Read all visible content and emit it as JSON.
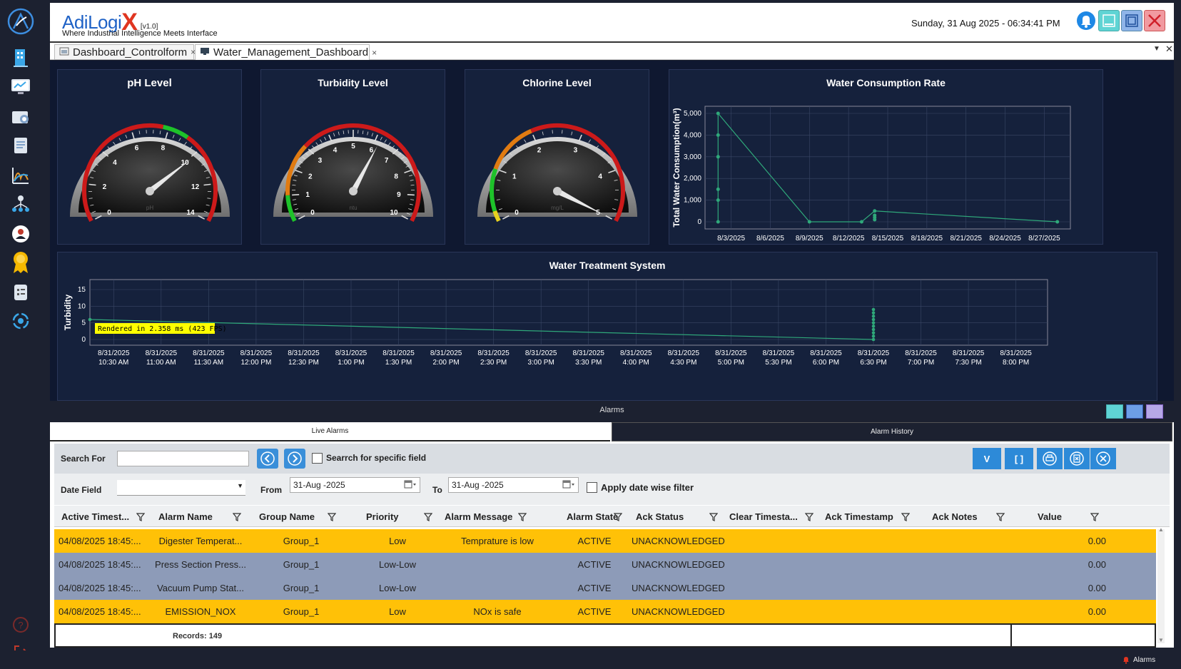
{
  "app": {
    "brand": "AdiLogi",
    "brand_x": "X",
    "version": "[v1.0]",
    "tagline": "Where Industrial Intelligence Meets Interface",
    "datetime": "Sunday, 31 Aug 2025 - 06:34:41 PM"
  },
  "tabs": [
    {
      "label": "Dashboard_Controlform",
      "close": "×"
    },
    {
      "label": "Water_Management_Dashboard",
      "close": "×"
    }
  ],
  "gauges": [
    {
      "title": "pH Level",
      "unit": "pH",
      "min": 0,
      "max": 14,
      "value": 10.1,
      "labels": [
        "0",
        "2",
        "4",
        "6",
        "8",
        "10",
        "12",
        "14"
      ]
    },
    {
      "title": "Turbidity Level",
      "unit": "ntu",
      "min": 0,
      "max": 10,
      "value": 6.2,
      "labels": [
        "0",
        "1",
        "2",
        "3",
        "4",
        "5",
        "6",
        "7",
        "8",
        "9",
        "10"
      ]
    },
    {
      "title": "Chlorine Level",
      "unit": "mg/L",
      "min": 0,
      "max": 5,
      "value": 5.0,
      "labels": [
        "0",
        "1",
        "2",
        "3",
        "4",
        "5"
      ]
    }
  ],
  "consumption_chart": {
    "title": "Water Consumption Rate",
    "ylabel": "Total Water Consumption(m³)",
    "y_ticks": [
      "5,000",
      "4,000",
      "3,000",
      "2,000",
      "1,000",
      "0"
    ],
    "x_ticks": [
      "8/3/2025",
      "8/6/2025",
      "8/9/2025",
      "8/12/2025",
      "8/15/2025",
      "8/18/2025",
      "8/21/2025",
      "8/24/2025",
      "8/27/2025"
    ]
  },
  "treatment_chart": {
    "title": "Water Treatment System",
    "ylabel": "Turbidity",
    "y_ticks": [
      "15",
      "10",
      "5",
      "0"
    ],
    "x_ticks": [
      [
        "8/31/2025",
        "10:30 AM"
      ],
      [
        "8/31/2025",
        "11:00 AM"
      ],
      [
        "8/31/2025",
        "11:30 AM"
      ],
      [
        "8/31/2025",
        "12:00 PM"
      ],
      [
        "8/31/2025",
        "12:30 PM"
      ],
      [
        "8/31/2025",
        "1:00 PM"
      ],
      [
        "8/31/2025",
        "1:30 PM"
      ],
      [
        "8/31/2025",
        "2:00 PM"
      ],
      [
        "8/31/2025",
        "2:30 PM"
      ],
      [
        "8/31/2025",
        "3:00 PM"
      ],
      [
        "8/31/2025",
        "3:30 PM"
      ],
      [
        "8/31/2025",
        "4:00 PM"
      ],
      [
        "8/31/2025",
        "4:30 PM"
      ],
      [
        "8/31/2025",
        "5:00 PM"
      ],
      [
        "8/31/2025",
        "5:30 PM"
      ],
      [
        "8/31/2025",
        "6:00 PM"
      ],
      [
        "8/31/2025",
        "6:30 PM"
      ],
      [
        "8/31/2025",
        "7:00 PM"
      ],
      [
        "8/31/2025",
        "7:30 PM"
      ],
      [
        "8/31/2025",
        "8:00 PM"
      ]
    ],
    "render_note": "Rendered in 2.358 ms (423 FPS)"
  },
  "chart_data": [
    {
      "type": "line",
      "title": "Water Consumption Rate",
      "ylabel": "Total Water Consumption(m³)",
      "ylim": [
        0,
        5000
      ],
      "xlim": [
        "2025-08-01",
        "2025-08-29"
      ],
      "series": [
        {
          "x": [
            "2025-08-02",
            "2025-08-02",
            "2025-08-02",
            "2025-08-02",
            "2025-08-02",
            "2025-08-02",
            "2025-08-09",
            "2025-08-13",
            "2025-08-14",
            "2025-08-14",
            "2025-08-14",
            "2025-08-14",
            "2025-08-28"
          ],
          "values": [
            0,
            1000,
            1500,
            3000,
            4000,
            5000,
            0,
            0,
            100,
            200,
            300,
            500,
            0
          ]
        }
      ]
    },
    {
      "type": "line",
      "title": "Water Treatment System",
      "ylabel": "Turbidity",
      "ylim": [
        0,
        15
      ],
      "xlim": [
        "10:15 AM",
        "8:20 PM"
      ],
      "series": [
        {
          "x": [
            "10:15 AM",
            "6:30 PM",
            "6:30 PM",
            "6:30 PM",
            "6:30 PM",
            "6:30 PM",
            "6:30 PM",
            "6:30 PM",
            "6:30 PM",
            "6:30 PM",
            "6:30 PM"
          ],
          "values": [
            6,
            0,
            1,
            2,
            3,
            4,
            5,
            6,
            7,
            8,
            9
          ]
        }
      ]
    }
  ],
  "alarms": {
    "header": "Alarms",
    "tabs": {
      "live": "Live Alarms",
      "history": "Alarm History"
    },
    "search_label": "Search For",
    "search_value": "",
    "specific_field_label": "Searrch for specific field",
    "date_field_label": "Date Field",
    "date_field_value": "",
    "from_label": "From",
    "from_value": "31-Aug -2025",
    "to_label": "To",
    "to_value": "31-Aug -2025",
    "apply_filter_label": "Apply date wise filter",
    "action_buttons": [
      "V",
      "[ ]"
    ],
    "columns": [
      "Active Timest...",
      "Alarm Name",
      "Group Name",
      "Priority",
      "Alarm Message",
      "Alarm State",
      "Ack Status",
      "Clear Timesta...",
      "Ack Timestamp",
      "Ack Notes",
      "Value"
    ],
    "rows": [
      {
        "active": "04/08/2025 18:45:...",
        "name": "Digester  Temperat...",
        "group": "Group_1",
        "priority": "Low",
        "message": "Temprature is low",
        "state": "ACTIVE",
        "ack": "UNACKNOWLEDGED",
        "clear": "",
        "ack_ts": "",
        "notes": "",
        "value": "0.00",
        "color": "#ffc107"
      },
      {
        "active": "04/08/2025 18:45:...",
        "name": "Press Section  Press...",
        "group": "Group_1",
        "priority": "Low-Low",
        "message": "",
        "state": "ACTIVE",
        "ack": "UNACKNOWLEDGED",
        "clear": "",
        "ack_ts": "",
        "notes": "",
        "value": "0.00",
        "color": "#8d9bb8"
      },
      {
        "active": "04/08/2025 18:45:...",
        "name": "Vacuum  Pump Stat...",
        "group": "Group_1",
        "priority": "Low-Low",
        "message": "",
        "state": "ACTIVE",
        "ack": "UNACKNOWLEDGED",
        "clear": "",
        "ack_ts": "",
        "notes": "",
        "value": "0.00",
        "color": "#8d9bb8"
      },
      {
        "active": "04/08/2025 18:45:...",
        "name": "EMISSION_NOX",
        "group": "Group_1",
        "priority": "Low",
        "message": "NOx is safe",
        "state": "ACTIVE",
        "ack": "UNACKNOWLEDGED",
        "clear": "",
        "ack_ts": "",
        "notes": "",
        "value": "0.00",
        "color": "#ffc107"
      }
    ],
    "records": "Records: 149"
  },
  "status": {
    "alarms": "Alarms"
  },
  "colors": {
    "accent": "#1f62c6",
    "brand_x": "#e03520",
    "series": "#2fa87a",
    "alarm_low": "#ffc107",
    "alarm_lowlow": "#8d9bb8"
  }
}
